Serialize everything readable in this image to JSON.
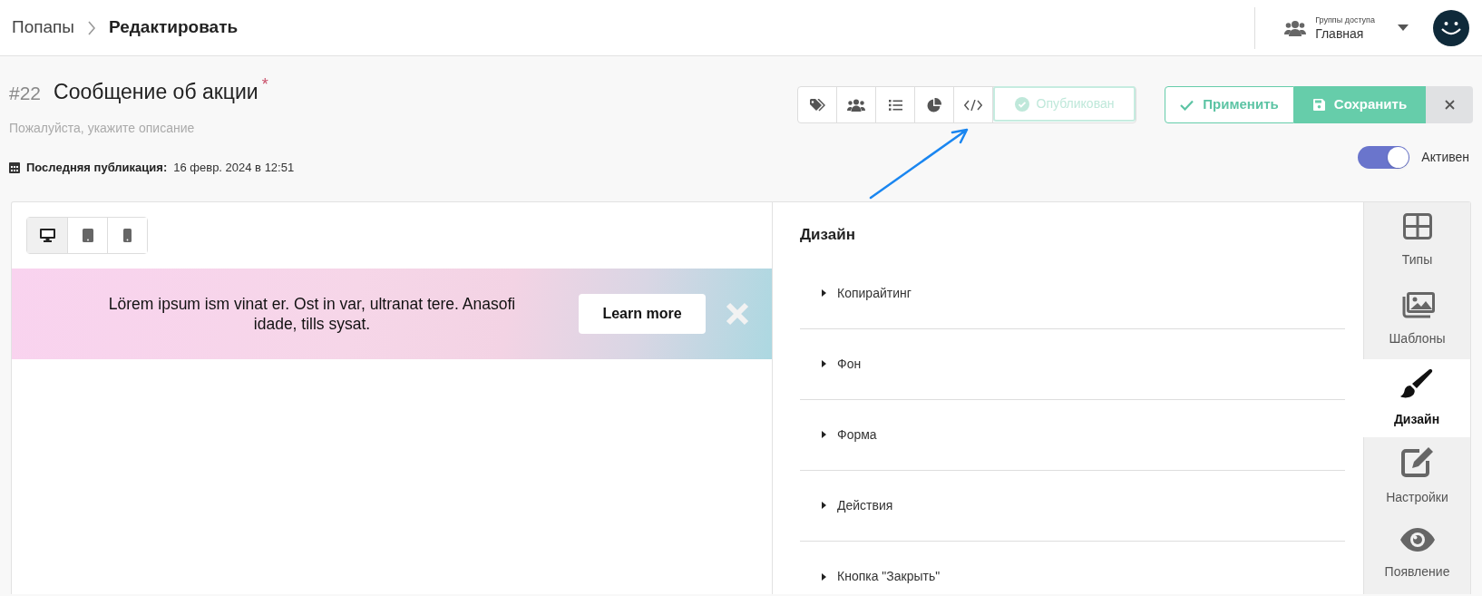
{
  "breadcrumb": [
    {
      "label": "Попапы"
    },
    {
      "label": "Редактировать"
    }
  ],
  "access_group": {
    "label": "Группы доступа",
    "value": "Главная"
  },
  "popup": {
    "number": "#22",
    "title": "Сообщение об акции",
    "required_mark": "*",
    "description_placeholder": "Пожалуйста, укажите описание",
    "last_published_label": "Последняя публикация:",
    "last_published_value": "16 февр. 2024 в 12:51"
  },
  "toolbar": {
    "published": {
      "label": "Опубликован",
      "disabled": true
    },
    "apply": "Применить",
    "save": "Сохранить"
  },
  "active_toggle": {
    "label": "Активен",
    "on": true
  },
  "devices": [
    {
      "selected": true
    },
    {
      "selected": false
    },
    {
      "selected": false
    }
  ],
  "preview_banner": {
    "text": "Lörem ipsum ism vinat er. Ost in var, ultranat tere. Anasofi idade, tills sysat.",
    "button": "Learn more"
  },
  "design_panel": {
    "title": "Дизайн",
    "sections": [
      {
        "label": "Копирайтинг",
        "expanded": false
      },
      {
        "label": "Фон",
        "expanded": false
      },
      {
        "label": "Форма",
        "expanded": false
      },
      {
        "label": "Действия",
        "expanded": false
      },
      {
        "label": "Кнопка \"Закрыть\"",
        "expanded": false
      }
    ]
  },
  "side_tabs": [
    {
      "label": "Типы",
      "selected": false
    },
    {
      "label": "Шаблоны",
      "selected": false
    },
    {
      "label": "Дизайн",
      "selected": true
    },
    {
      "label": "Настройки",
      "selected": false
    },
    {
      "label": "Появление",
      "selected": false
    }
  ]
}
